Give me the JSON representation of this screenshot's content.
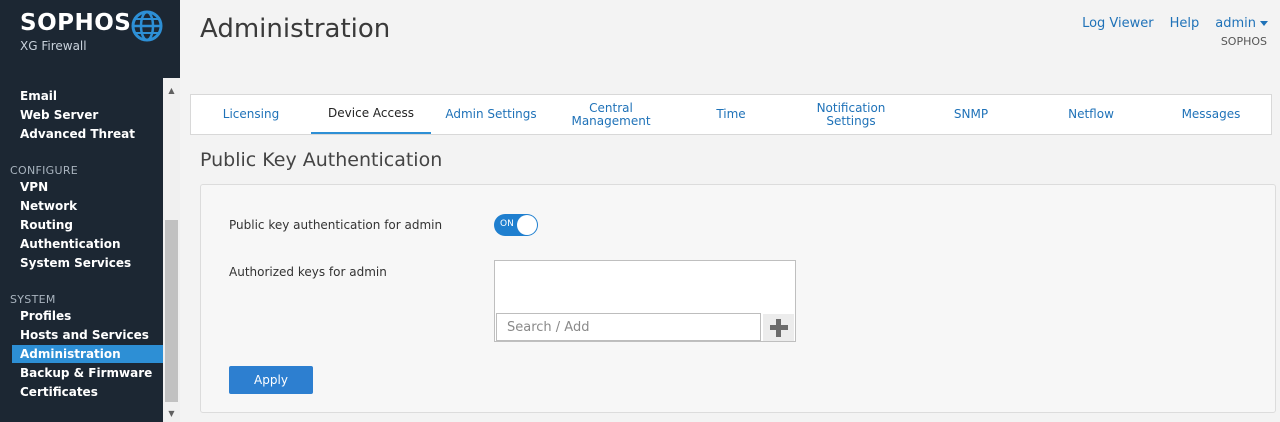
{
  "brand": {
    "name": "SOPHOS",
    "product": "XG Firewall"
  },
  "nav": {
    "items_top": [
      "Email",
      "Web Server",
      "Advanced Threat"
    ],
    "configure_label": "CONFIGURE",
    "configure_items": [
      "VPN",
      "Network",
      "Routing",
      "Authentication",
      "System Services"
    ],
    "system_label": "SYSTEM",
    "system_items": [
      "Profiles",
      "Hosts and Services",
      "Administration",
      "Backup & Firmware",
      "Certificates"
    ],
    "active_item": "Administration"
  },
  "header": {
    "title": "Administration",
    "log_viewer": "Log Viewer",
    "help": "Help",
    "user": "admin",
    "org": "SOPHOS"
  },
  "tabs": [
    {
      "label": "Licensing"
    },
    {
      "label": "Device Access",
      "active": true
    },
    {
      "label": "Admin Settings"
    },
    {
      "label": "Central\nManagement"
    },
    {
      "label": "Time"
    },
    {
      "label": "Notification\nSettings"
    },
    {
      "label": "SNMP"
    },
    {
      "label": "Netflow"
    },
    {
      "label": "Messages"
    }
  ],
  "section": {
    "title": "Public Key Authentication",
    "pubkey_label": "Public key authentication for admin",
    "toggle_state": "ON",
    "keys_label": "Authorized keys for admin",
    "search_placeholder": "Search / Add",
    "apply_label": "Apply"
  },
  "colors": {
    "sidebar_bg": "#1c2733",
    "accent": "#2d8fd5",
    "link": "#1f72b8"
  },
  "icons": {
    "brand_logo": "globe-icon",
    "add": "plus-icon",
    "scroll_up": "arrow-up-icon",
    "scroll_down": "arrow-down-icon",
    "user_menu": "caret-down-icon"
  }
}
